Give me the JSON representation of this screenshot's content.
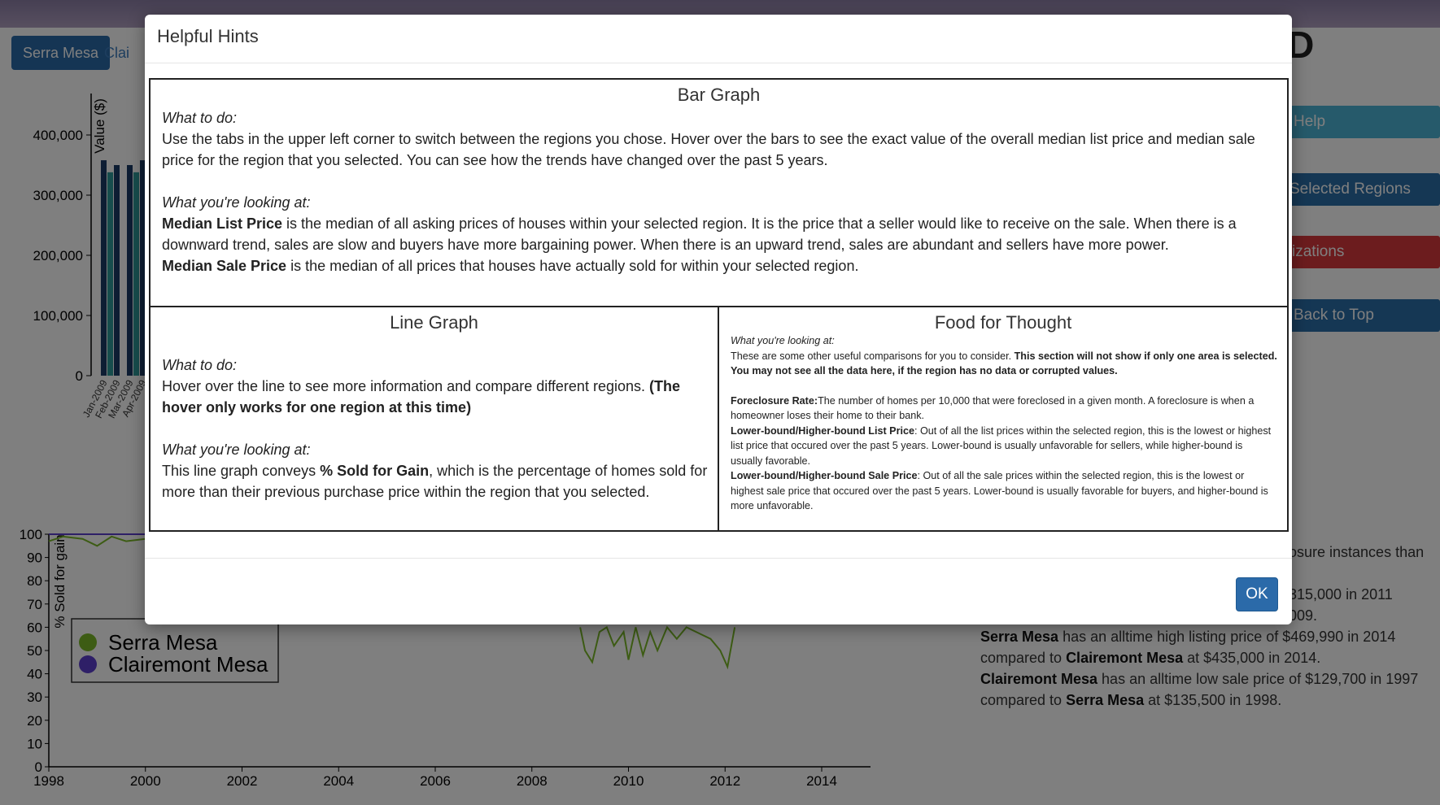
{
  "header": {
    "brand_text": "ICEPAD",
    "tabs": [
      {
        "label": "Serra Mesa"
      },
      {
        "label": "Clairemont Mesa"
      }
    ]
  },
  "sidebar": {
    "help": "Help",
    "selected_regions": "Selected Regions",
    "visualizations": "r Visualizations",
    "back_to_top": "Back to Top"
  },
  "chart_data": [
    {
      "type": "bar",
      "ylabel": "Value ($)",
      "yticks": [
        "0",
        "100,000",
        "200,000",
        "300,000",
        "400,000"
      ],
      "ylim": [
        0,
        450000
      ],
      "categories": [
        "Jan-2009",
        "Feb-2009",
        "Mar-2009",
        "Apr-2009"
      ],
      "series": [
        {
          "values": [
            358000,
            350000,
            350000,
            358000
          ],
          "color": "#1a3a66"
        },
        {
          "values": [
            338000,
            0,
            338000,
            0
          ],
          "color": "#2e9a9a"
        }
      ]
    },
    {
      "type": "line",
      "ylabel": "% Sold for gain",
      "yticks": [
        "0",
        "10",
        "20",
        "30",
        "40",
        "50",
        "60",
        "70",
        "80",
        "90",
        "100"
      ],
      "xticks": [
        "1998",
        "2000",
        "2002",
        "2004",
        "2006",
        "2008",
        "2010",
        "2012",
        "2014"
      ],
      "ylim": [
        0,
        100
      ],
      "xlim": [
        1998,
        2015
      ],
      "series": [
        {
          "name": "Serra Mesa",
          "color": "#7ab929"
        },
        {
          "name": "Clairemont Mesa",
          "color": "#5d3fcf"
        }
      ]
    }
  ],
  "right_panel": {
    "line1_tail": "osure instances than",
    "line2_tail": "315,000 in 2011",
    "line3_tail": "009.",
    "s1_name": "Serra Mesa",
    "s1_text": " has an alltime high listing price of $469,990 in 2014",
    "s1b_pre": "compared to ",
    "s1b_name": "Clairemont Mesa",
    "s1b_post": " at $435,000 in 2014.",
    "s2_name": "Clairemont Mesa",
    "s2_text": " has an alltime low sale price of $129,700 in 1997",
    "s2b_pre": "compared to ",
    "s2b_name": "Serra Mesa",
    "s2b_post": " at $135,500 in 1998."
  },
  "modal": {
    "title": "Helpful Hints",
    "ok_label": "OK",
    "bar": {
      "title": "Bar Graph",
      "todo_label": "What to do:",
      "todo_text": "Use the tabs in the upper left corner to switch between the regions you chose. Hover over the bars to see the exact value of the overall median list price and median sale price for the region that you selected. You can see how the trends have changed over the past 5 years.",
      "looking_label": "What you're looking at:",
      "mlp_term": "Median List Price",
      "mlp_text": " is the median of all asking prices of houses within your selected region. It is the price that a seller would like to receive on the sale. When there is a downward trend, sales are slow and buyers have more bargaining power. When there is an upward trend, sales are abundant and sellers have more power.",
      "msp_term": "Median Sale Price",
      "msp_text": " is the median of all prices that houses have actually sold for within your selected region."
    },
    "line": {
      "title": "Line Graph",
      "todo_label": "What to do:",
      "todo_text": "Hover over the line to see more information and compare different regions. ",
      "todo_bold": "(The hover only works for one region at this time)",
      "looking_label": "What you're looking at:",
      "looking_pre": "This line graph conveys ",
      "looking_term": "% Sold for Gain",
      "looking_post": ", which is the percentage of homes sold for more than their previous purchase price within the region that you selected."
    },
    "food": {
      "title": "Food for Thought",
      "looking_label": "What you're looking at:",
      "intro": "These are some other useful comparisons for you to consider. ",
      "intro_bold": "This section will not show if only one area is selected. You may not see all the data here, if the region has no data or corrupted values.",
      "fr_term": "Foreclosure Rate:",
      "fr_text": "The number of homes per 10,000 that were foreclosed in a given month. A foreclosure is when a homeowner loses their home to their bank.",
      "lp_term": "Lower-bound/Higher-bound List Price",
      "lp_text": ": Out of all the list prices within the selected region, this is the lowest or highest list price that occured over the past 5 years. Lower-bound is usually unfavorable for sellers, while higher-bound is usually favorable.",
      "sp_term": "Lower-bound/Higher-bound Sale Price",
      "sp_text": ": Out of all the sale prices within the selected region, this is the lowest or highest sale price that occured over the past 5 years. Lower-bound is usually favorable for buyers, and higher-bound is more unfavorable."
    }
  }
}
